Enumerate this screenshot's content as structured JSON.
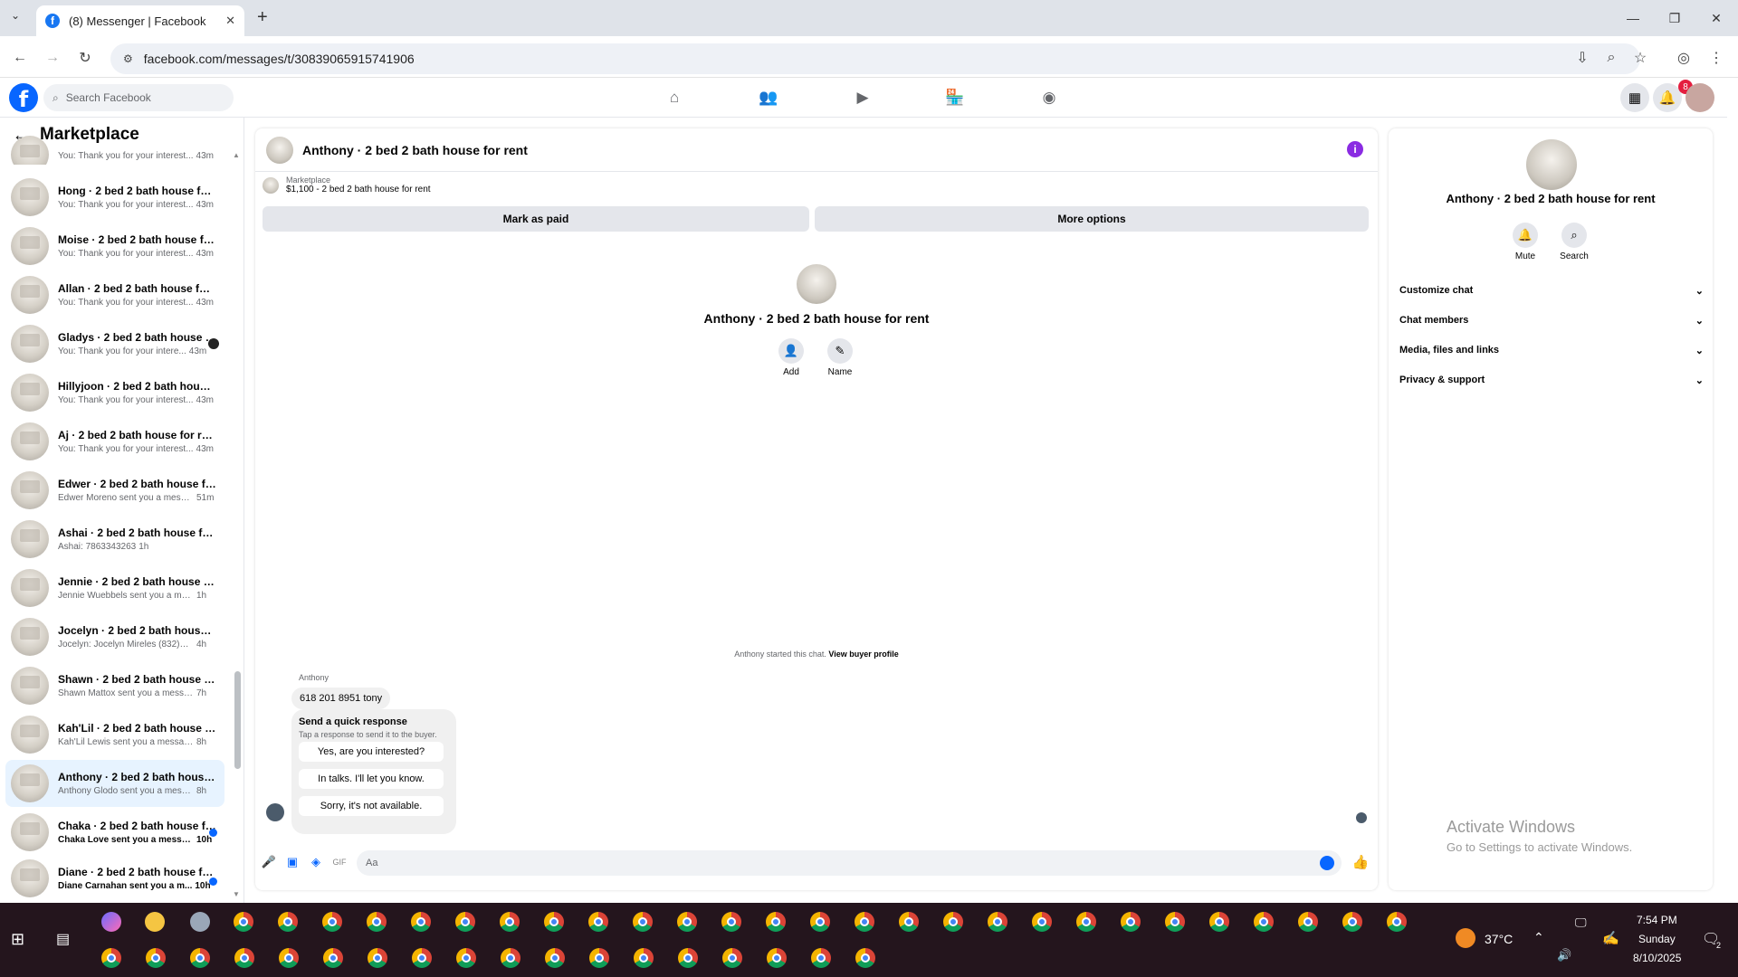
{
  "browser": {
    "tab_title": "(8) Messenger | Facebook",
    "url": "facebook.com/messages/t/30839065915741906"
  },
  "fb": {
    "search_placeholder": "Search Facebook",
    "notification_count": "8"
  },
  "left": {
    "title": "Marketplace",
    "conversations": [
      {
        "name": "",
        "preview": "You: Thank you for your interest...",
        "time": "43m"
      },
      {
        "name": "Hong · 2 bed 2 bath house for r...",
        "preview": "You: Thank you for your interest...",
        "time": "43m"
      },
      {
        "name": "Moise · 2 bed 2 bath house for ...",
        "preview": "You: Thank you for your interest...",
        "time": "43m"
      },
      {
        "name": "Allan · 2 bed 2 bath house for r...",
        "preview": "You: Thank you for your interest...",
        "time": "43m"
      },
      {
        "name": "Gladys · 2 bed 2 bath house f...",
        "preview": "You: Thank you for your intere...",
        "time": "43m"
      },
      {
        "name": "Hillyjoon · 2 bed 2 bath house f...",
        "preview": "You: Thank you for your interest...",
        "time": "43m"
      },
      {
        "name": "Aj · 2 bed 2 bath house for rent",
        "preview": "You: Thank you for your interest...",
        "time": "43m"
      },
      {
        "name": "Edwer · 2 bed 2 bath house for ...",
        "preview": "Edwer Moreno sent you a messa...",
        "time": "51m"
      },
      {
        "name": "Ashai · 2 bed 2 bath house for r...",
        "preview": "Ashai: 7863343263",
        "time": "1h"
      },
      {
        "name": "Jennie · 2 bed 2 bath house for ...",
        "preview": "Jennie Wuebbels sent you a messa...",
        "time": "1h"
      },
      {
        "name": "Jocelyn · 2 bed 2 bath house fo...",
        "preview": "Jocelyn: Jocelyn Mireles (832)578-...",
        "time": "4h"
      },
      {
        "name": "Shawn · 2 bed 2 bath house for ...",
        "preview": "Shawn Mattox sent you a message...",
        "time": "7h"
      },
      {
        "name": "Kah'Lil · 2 bed 2 bath house for ...",
        "preview": "Kah'Lil Lewis sent you a message a...",
        "time": "8h"
      },
      {
        "name": "Anthony · 2 bed 2 bath house f...",
        "preview": "Anthony Glodo sent you a messag...",
        "time": "8h"
      },
      {
        "name": "Chaka · 2 bed 2 bath house fo...",
        "preview": "Chaka Love sent you a messa...",
        "time": "10h"
      },
      {
        "name": "Diane · 2 bed 2 bath house fo...",
        "preview": "Diane Carnahan sent you a m...",
        "time": "10h"
      }
    ]
  },
  "chat": {
    "title": "Anthony · 2 bed 2 bath house for rent",
    "listing_label": "Marketplace",
    "listing_detail": "$1,100 - 2 bed 2 bath house for rent",
    "mark_paid": "Mark as paid",
    "more_options": "More options",
    "intro_name": "Anthony · 2 bed 2 bath house for rent",
    "add_label": "Add",
    "name_label": "Name",
    "system_text": "Anthony started this chat.",
    "system_link": "View buyer profile",
    "sender": "Anthony",
    "phone_message": "618 201 8951 tony",
    "qr_title": "Send a quick response",
    "qr_sub": "Tap a response to send it to the buyer.",
    "qr_options": [
      "Yes, are you interested?",
      "In talks. I'll let you know.",
      "Sorry, it's not available."
    ],
    "composer_placeholder": "Aa"
  },
  "right": {
    "name": "Anthony · 2 bed 2 bath house for rent",
    "mute": "Mute",
    "search": "Search",
    "sections": [
      "Customize chat",
      "Chat members",
      "Media, files and links",
      "Privacy & support"
    ]
  },
  "windows": {
    "activate_title": "Activate Windows",
    "activate_sub": "Go to Settings to activate Windows."
  },
  "taskbar": {
    "temperature": "37°C",
    "time": "7:54 PM",
    "day": "Sunday",
    "date": "8/10/2025",
    "notifications": "2"
  }
}
